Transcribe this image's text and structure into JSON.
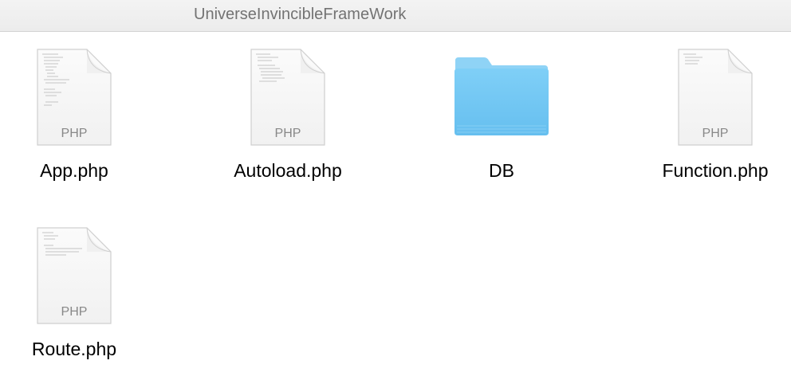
{
  "window": {
    "title": "UniverseInvincibleFrameWork"
  },
  "files": [
    {
      "name": "App.php",
      "kind": "php",
      "type_label": "PHP",
      "icon": "php-file-icon"
    },
    {
      "name": "Autoload.php",
      "kind": "php",
      "type_label": "PHP",
      "icon": "php-file-icon"
    },
    {
      "name": "DB",
      "kind": "folder",
      "icon": "folder-icon"
    },
    {
      "name": "Function.php",
      "kind": "php",
      "type_label": "PHP",
      "icon": "php-file-icon"
    },
    {
      "name": "Route.php",
      "kind": "php",
      "type_label": "PHP",
      "icon": "php-file-icon"
    }
  ],
  "colors": {
    "folder": "#6fc4f1",
    "folder_tab": "#8fd3f6",
    "document_border": "#cfcfcf"
  }
}
